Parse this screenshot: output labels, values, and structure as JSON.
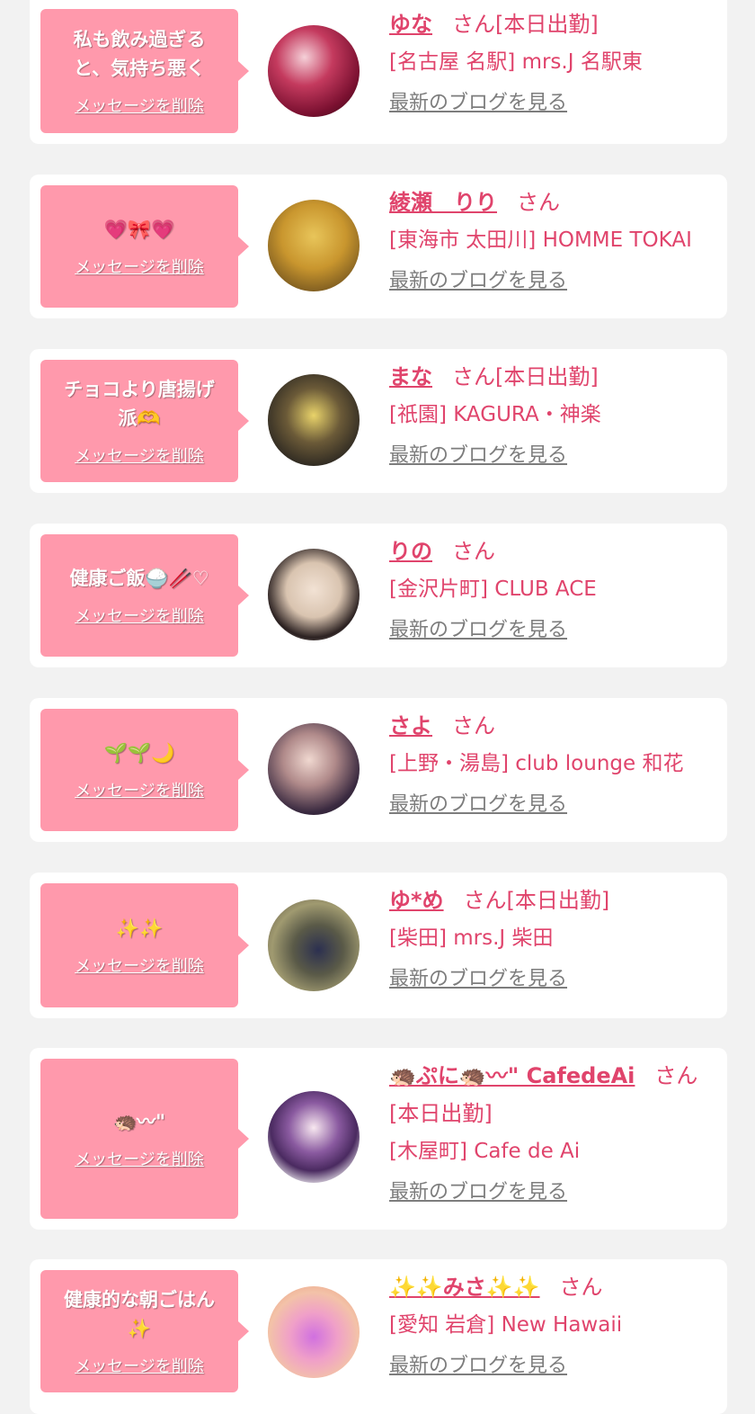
{
  "cards": [
    {
      "bubble_text": "私も飲み過ぎる\nと、気持ち悪く",
      "delete_label": "メッセージを削除",
      "name": "ゆな",
      "suffix": "さん[本日出勤]",
      "shop": "[名古屋 名駅] mrs.J 名駅東",
      "blog_label": "最新のブログを見る"
    },
    {
      "bubble_text": "💗🎀💗",
      "delete_label": "メッセージを削除",
      "name": "綾瀬　りり",
      "suffix": "さん",
      "shop": "[東海市 太田川] HOMME TOKAI",
      "blog_label": "最新のブログを見る"
    },
    {
      "bubble_text": "チョコより唐揚げ\n派🫶",
      "delete_label": "メッセージを削除",
      "name": "まな",
      "suffix": "さん[本日出勤]",
      "shop": "[祇園] KAGURA・神楽",
      "blog_label": "最新のブログを見る"
    },
    {
      "bubble_text": "健康ご飯🍚🥢♡",
      "delete_label": "メッセージを削除",
      "name": "りの",
      "suffix": "さん",
      "shop": "[金沢片町] CLUB ACE",
      "blog_label": "最新のブログを見る"
    },
    {
      "bubble_text": "🌱🌱🌙",
      "delete_label": "メッセージを削除",
      "name": "さよ",
      "suffix": "さん",
      "shop": "[上野・湯島] club lounge 和花",
      "blog_label": "最新のブログを見る"
    },
    {
      "bubble_text": "✨✨",
      "delete_label": "メッセージを削除",
      "name": "ゆ*め",
      "suffix": "さん[本日出勤]",
      "shop": "[柴田] mrs.J 柴田",
      "blog_label": "最新のブログを見る"
    },
    {
      "bubble_text": "🦔〰\"",
      "delete_label": "メッセージを削除",
      "name": "🦔ぷに🦔〰\" CafedeAi",
      "suffix": "さん",
      "extra": "[本日出勤]",
      "shop": "[木屋町] Cafe de Ai",
      "blog_label": "最新のブログを見る"
    },
    {
      "bubble_text": "健康的な朝ごはん\n✨",
      "delete_label": "メッセージを削除",
      "name": "✨✨みさ✨✨",
      "suffix": "さん",
      "shop": "[愛知 岩倉] New Hawaii",
      "blog_label": "最新のブログを見る"
    }
  ]
}
